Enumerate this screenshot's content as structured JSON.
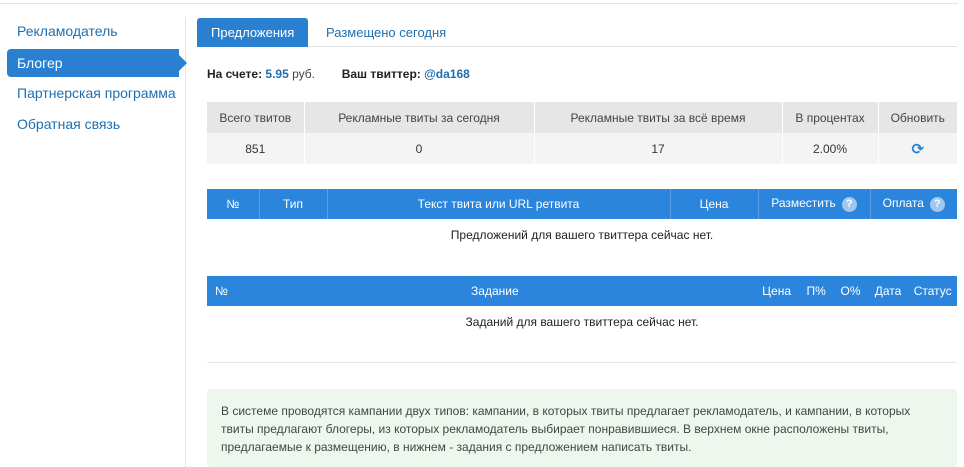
{
  "sidebar": {
    "items": [
      {
        "label": "Рекламодатель",
        "active": false
      },
      {
        "label": "Блогер",
        "active": true
      },
      {
        "label": "Партнерская программа",
        "active": false
      },
      {
        "label": "Обратная связь",
        "active": false
      }
    ]
  },
  "tabs": [
    {
      "label": "Предложения",
      "active": true
    },
    {
      "label": "Размещено сегодня",
      "active": false
    }
  ],
  "account": {
    "balance_label": "На счете:",
    "balance_value": "5.95",
    "balance_unit": "руб.",
    "twitter_label": "Ваш твиттер:",
    "twitter_handle": "@da168"
  },
  "stats": {
    "headers": [
      "Всего твитов",
      "Рекламные твиты за сегодня",
      "Рекламные твиты за всё время",
      "В процентах",
      "Обновить"
    ],
    "row": [
      "851",
      "0",
      "17",
      "2.00%"
    ],
    "refresh_icon": "refresh-icon"
  },
  "offers_table": {
    "headers": [
      "№",
      "Тип",
      "Текст твита или URL ретвита",
      "Цена",
      "Разместить",
      "Оплата"
    ],
    "help_glyph": "?",
    "empty_message": "Предложений для вашего твиттера сейчас нет."
  },
  "tasks_table": {
    "headers": [
      "№",
      "Задание",
      "Цена",
      "П%",
      "О%",
      "Дата",
      "Статус"
    ],
    "empty_message": "Заданий для вашего твиттера сейчас нет."
  },
  "info_text": "В системе проводятся кампании двух типов: кампании, в которых твиты предлагает рекламодатель, и кампании, в которых твиты предлагают блогеры, из которых рекламодатель выбирает понравившиеся. В верхнем окне расположены твиты, предлагаемые к размещению, в нижнем - задания с предложением написать твиты.",
  "colors": {
    "accent": "#2a80d0",
    "header_blue": "#2b85dc",
    "info_bg": "#eef7ed"
  }
}
